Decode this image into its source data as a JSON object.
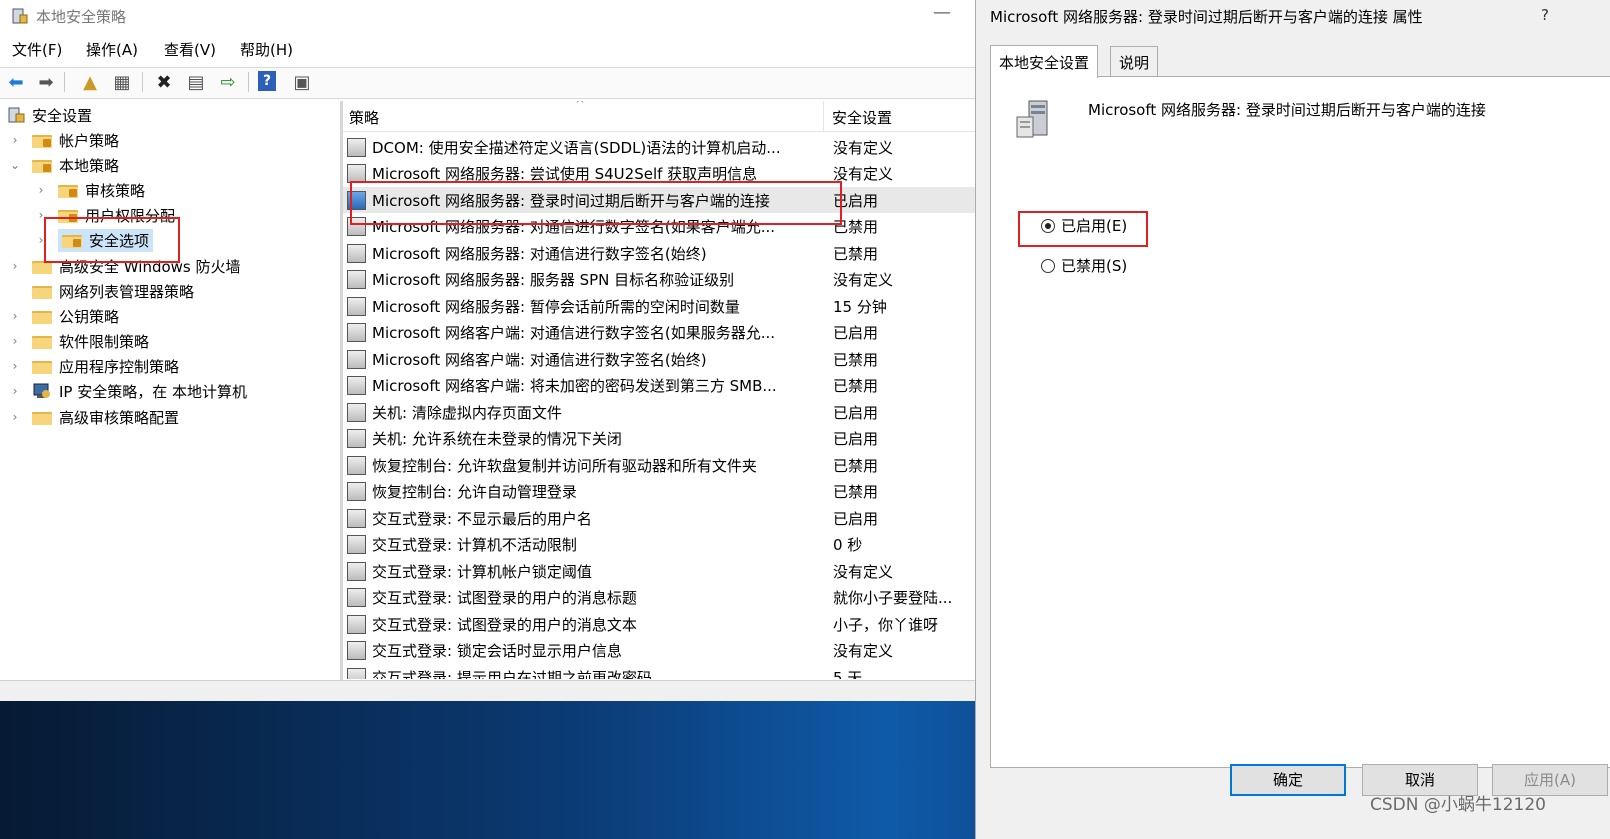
{
  "window": {
    "title": "本地安全策略",
    "minimize": "—"
  },
  "menu": [
    "文件(F)",
    "操作(A)",
    "查看(V)",
    "帮助(H)"
  ],
  "toolbar": {
    "icons": [
      "back-icon",
      "forward-icon",
      "up-folder-icon",
      "show-hide-tree-icon",
      "delete-icon",
      "properties-icon",
      "export-icon",
      "help-icon",
      "console-icon"
    ]
  },
  "tree": {
    "root": "安全设置",
    "items": [
      {
        "label": "帐户策略"
      },
      {
        "label": "本地策略"
      },
      {
        "label": "审核策略"
      },
      {
        "label": "用户权限分配"
      },
      {
        "label": "安全选项"
      },
      {
        "label": "高级安全 Windows 防火墙"
      },
      {
        "label": "网络列表管理器策略"
      },
      {
        "label": "公钥策略"
      },
      {
        "label": "软件限制策略"
      },
      {
        "label": "应用程序控制策略"
      },
      {
        "label": "IP 安全策略，在 本地计算机"
      },
      {
        "label": "高级审核策略配置"
      }
    ]
  },
  "list": {
    "headers": {
      "policy": "策略",
      "setting": "安全设置"
    },
    "rows": [
      {
        "name": "DCOM: 使用安全描述符定义语言(SDDL)语法的计算机启动...",
        "value": "没有定义"
      },
      {
        "name": "Microsoft 网络服务器: 尝试使用 S4U2Self 获取声明信息",
        "value": "没有定义"
      },
      {
        "name": "Microsoft 网络服务器: 登录时间过期后断开与客户端的连接",
        "value": "已启用"
      },
      {
        "name": "Microsoft 网络服务器: 对通信进行数字签名(如果客户端允...",
        "value": "已禁用"
      },
      {
        "name": "Microsoft 网络服务器: 对通信进行数字签名(始终)",
        "value": "已禁用"
      },
      {
        "name": "Microsoft 网络服务器: 服务器 SPN 目标名称验证级别",
        "value": "没有定义"
      },
      {
        "name": "Microsoft 网络服务器: 暂停会话前所需的空闲时间数量",
        "value": "15 分钟"
      },
      {
        "name": "Microsoft 网络客户端: 对通信进行数字签名(如果服务器允...",
        "value": "已启用"
      },
      {
        "name": "Microsoft 网络客户端: 对通信进行数字签名(始终)",
        "value": "已禁用"
      },
      {
        "name": "Microsoft 网络客户端: 将未加密的密码发送到第三方 SMB...",
        "value": "已禁用"
      },
      {
        "name": "关机: 清除虚拟内存页面文件",
        "value": "已启用"
      },
      {
        "name": "关机: 允许系统在未登录的情况下关闭",
        "value": "已启用"
      },
      {
        "name": "恢复控制台: 允许软盘复制并访问所有驱动器和所有文件夹",
        "value": "已禁用"
      },
      {
        "name": "恢复控制台: 允许自动管理登录",
        "value": "已禁用"
      },
      {
        "name": "交互式登录: 不显示最后的用户名",
        "value": "已启用"
      },
      {
        "name": "交互式登录: 计算机不活动限制",
        "value": "0 秒"
      },
      {
        "name": "交互式登录: 计算机帐户锁定阈值",
        "value": "没有定义"
      },
      {
        "name": "交互式登录: 试图登录的用户的消息标题",
        "value": "就你小子要登陆..."
      },
      {
        "name": "交互式登录: 试图登录的用户的消息文本",
        "value": "小子，你丫谁呀"
      },
      {
        "name": "交互式登录: 锁定会话时显示用户信息",
        "value": "没有定义"
      },
      {
        "name": "交互式登录: 提示用户在过期之前更改密码",
        "value": "5 天"
      }
    ]
  },
  "dialog": {
    "title": "Microsoft 网络服务器: 登录时间过期后断开与客户端的连接 属性",
    "help": "?",
    "tabs": [
      "本地安全设置",
      "说明"
    ],
    "policy_name": "Microsoft 网络服务器: 登录时间过期后断开与客户端的连接",
    "options": [
      {
        "label": "已启用(E)",
        "checked": true
      },
      {
        "label": "已禁用(S)",
        "checked": false
      }
    ],
    "buttons": {
      "ok": "确定",
      "cancel": "取消",
      "apply": "应用(A)"
    }
  },
  "watermark": "CSDN @小蜗牛12120",
  "colors": {
    "selection": "#cce4f7",
    "annotation": "#e02020",
    "ok_border": "#0078d7"
  }
}
